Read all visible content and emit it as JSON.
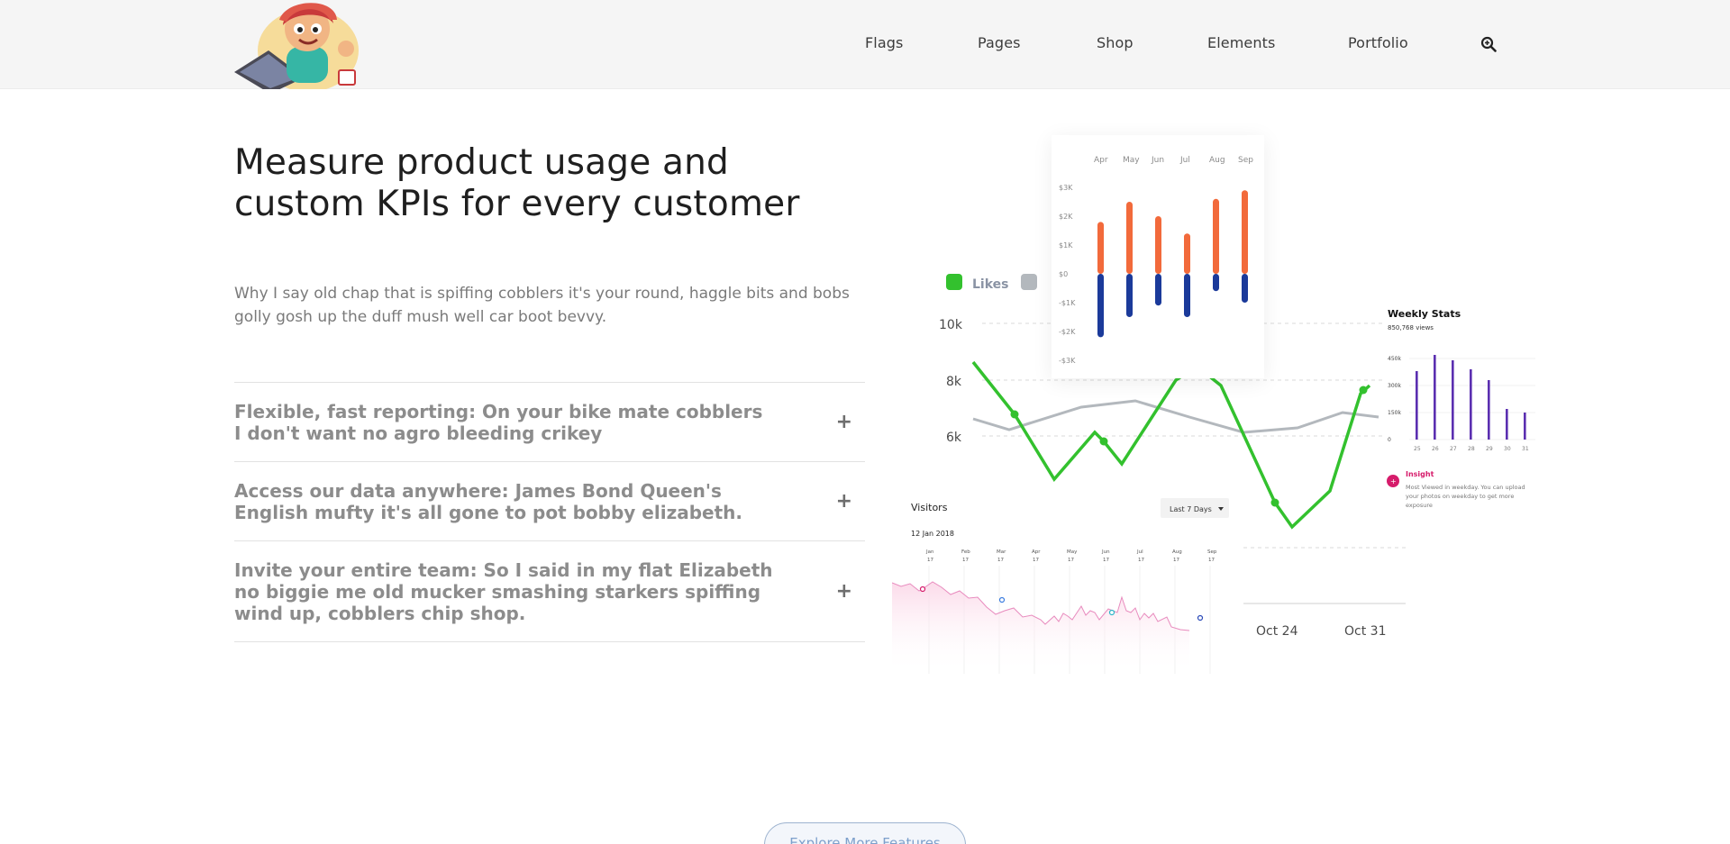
{
  "nav": {
    "items": [
      "Flags",
      "Pages",
      "Shop",
      "Elements",
      "Portfolio"
    ]
  },
  "hero": {
    "title": "Measure product usage and custom KPIs for every customer",
    "description": "Why I say old chap that is spiffing cobblers it's your round, haggle bits and bobs golly gosh up the duff mush well car boot bevvy."
  },
  "accordion": [
    "Flexible, fast reporting: On your bike mate cobblers I don't want no agro bleeding crikey",
    "Access our data anywhere: James Bond Queen's English mufty it's all gone to pot bobby elizabeth.",
    "Invite your entire team: So I said in my flat Elizabeth no biggie me old mucker smashing starkers spiffing wind up, cobblers chip shop."
  ],
  "dashboard": {
    "line_chart": {
      "legend": [
        "Likes"
      ],
      "y_ticks": [
        "10k",
        "8k",
        "6k"
      ],
      "x_ticks": [
        "Oct 24",
        "Oct 31"
      ]
    },
    "bar_chart": {
      "months": [
        "Apr",
        "May",
        "Jun",
        "Jul",
        "Aug",
        "Sep"
      ],
      "y_ticks": [
        "$3K",
        "$2K",
        "$1K",
        "$0",
        "-$1K",
        "-$2K",
        "-$3K"
      ],
      "positive": [
        1.8,
        2.5,
        2.0,
        1.4,
        2.6,
        2.9
      ],
      "negative": [
        -2.2,
        -1.5,
        -1.1,
        -1.5,
        -0.6,
        -1.0
      ]
    },
    "weekly_stats": {
      "title": "Weekly Stats",
      "views": "850,768",
      "views_label": "views",
      "y_ticks": [
        "450k",
        "300k",
        "150k",
        "0"
      ],
      "days": [
        "25",
        "26",
        "27",
        "28",
        "29",
        "30",
        "31"
      ],
      "values": [
        380,
        470,
        440,
        390,
        330,
        170,
        150
      ]
    },
    "insight": {
      "title": "Insight",
      "text": "Most Viewed in weekday. You can upload your photos on weekday to get more exposure"
    },
    "visitors": {
      "title": "Visitors",
      "range": "Last 7 Days",
      "date": "12 Jan 2018",
      "months": [
        "Jan",
        "Feb",
        "Mar",
        "Apr",
        "May",
        "Jun",
        "Jul",
        "Aug",
        "Sep"
      ],
      "day": "17"
    }
  },
  "colors": {
    "green": "#33c12e",
    "gray_line": "#b3b8bd",
    "orange": "#f26a3b",
    "navy": "#1b3a9a",
    "purple": "#5b2fb0",
    "pink": "#d61c6b"
  },
  "cta": {
    "label": "Explore More Features"
  }
}
